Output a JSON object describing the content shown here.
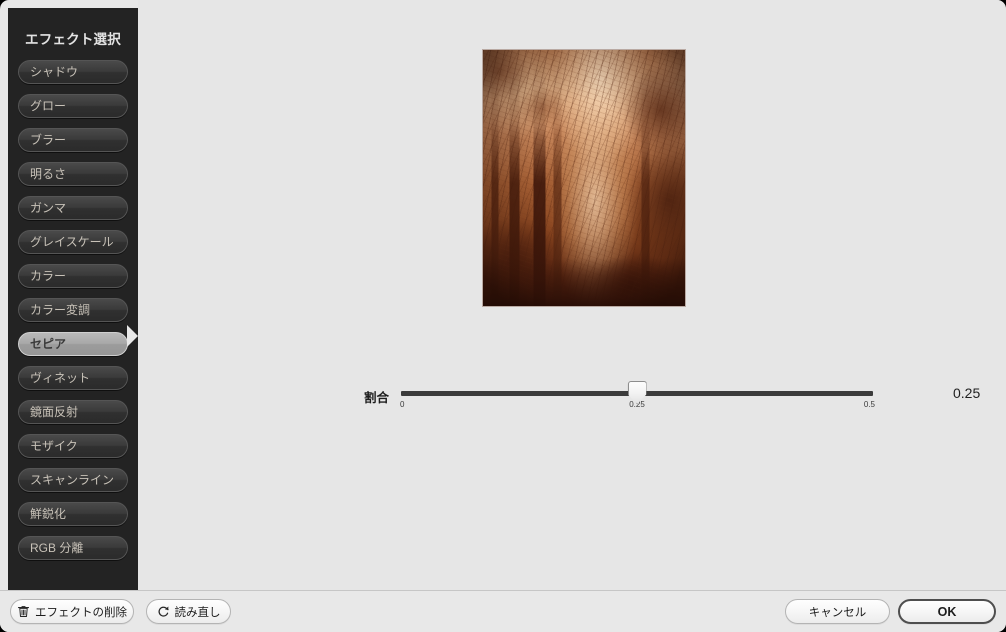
{
  "sidebar": {
    "title": "エフェクト選択",
    "items": [
      {
        "label": "シャドウ",
        "selected": false
      },
      {
        "label": "グロー",
        "selected": false
      },
      {
        "label": "ブラー",
        "selected": false
      },
      {
        "label": "明るさ",
        "selected": false
      },
      {
        "label": "ガンマ",
        "selected": false
      },
      {
        "label": "グレイスケール",
        "selected": false
      },
      {
        "label": "カラー",
        "selected": false
      },
      {
        "label": "カラー変調",
        "selected": false
      },
      {
        "label": "セピア",
        "selected": true
      },
      {
        "label": "ヴィネット",
        "selected": false
      },
      {
        "label": "鏡面反射",
        "selected": false
      },
      {
        "label": "モザイク",
        "selected": false
      },
      {
        "label": "スキャンライン",
        "selected": false
      },
      {
        "label": "鮮鋭化",
        "selected": false
      },
      {
        "label": "RGB 分離",
        "selected": false
      }
    ]
  },
  "preview": {
    "alt_name": "sepia-forest-photo"
  },
  "slider": {
    "label": "割合",
    "value": "0.25",
    "tick_min": "0",
    "tick_mid": "0.25",
    "tick_max": "0.5"
  },
  "footer": {
    "delete_effect_label": "エフェクトの削除",
    "delete_effect_icon": "trash-icon",
    "reload_label": "読み直し",
    "reload_icon": "reload-ccw-icon",
    "cancel_label": "キャンセル",
    "ok_label": "OK"
  },
  "colors": {
    "sidebar_bg": "#232323",
    "content_bg": "#e6e6e6",
    "footer_bg": "#e8e8e8",
    "selected_item_bg": "#a8a8a8",
    "track": "#3b3b3b"
  }
}
